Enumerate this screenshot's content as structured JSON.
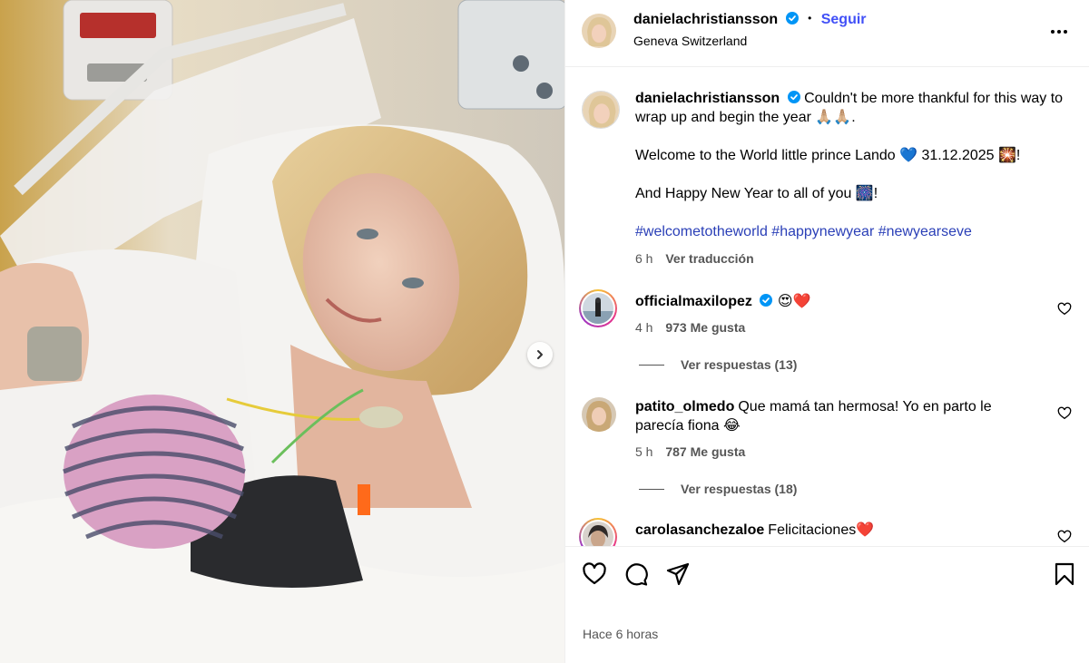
{
  "post": {
    "author": "danielachristiansson",
    "follow_label": "Seguir",
    "location": "Geneva Switzerland",
    "caption_line1": "Couldn't be more thankful for this way to wrap up and begin the year 🙏🏼🙏🏼.",
    "caption_line2": "Welcome to the World little prince Lando 💙 31.12.2025 🎇!",
    "caption_line3": "And Happy New Year to all of you 🎆!",
    "hashtags": "#welcometotheworld #happynewyear #newyearseve",
    "caption_time": "6 h",
    "translate_label": "Ver traducción",
    "posted_time": "Hace 6 horas"
  },
  "comments": [
    {
      "username": "officialmaxilopez",
      "text": "😍❤️",
      "time": "4 h",
      "likes": "973 Me gusta",
      "replies": "Ver respuestas (13)"
    },
    {
      "username": "patito_olmedo",
      "text": "Que mamá tan hermosa! Yo en parto le parecía fiona 😂",
      "time": "5 h",
      "likes": "787 Me gusta",
      "replies": "Ver respuestas (18)"
    },
    {
      "username": "carolasanchezaloe",
      "text": "Felicitaciones❤️"
    }
  ],
  "colors": {
    "accent": "#4150f7",
    "hashtag": "#2a3fb7",
    "verified": "#0095f6",
    "muted": "#555555"
  },
  "icons": [
    "verified-badge-icon",
    "more-options-icon",
    "chevron-right-icon",
    "heart-icon",
    "comment-icon",
    "share-icon",
    "bookmark-icon"
  ]
}
